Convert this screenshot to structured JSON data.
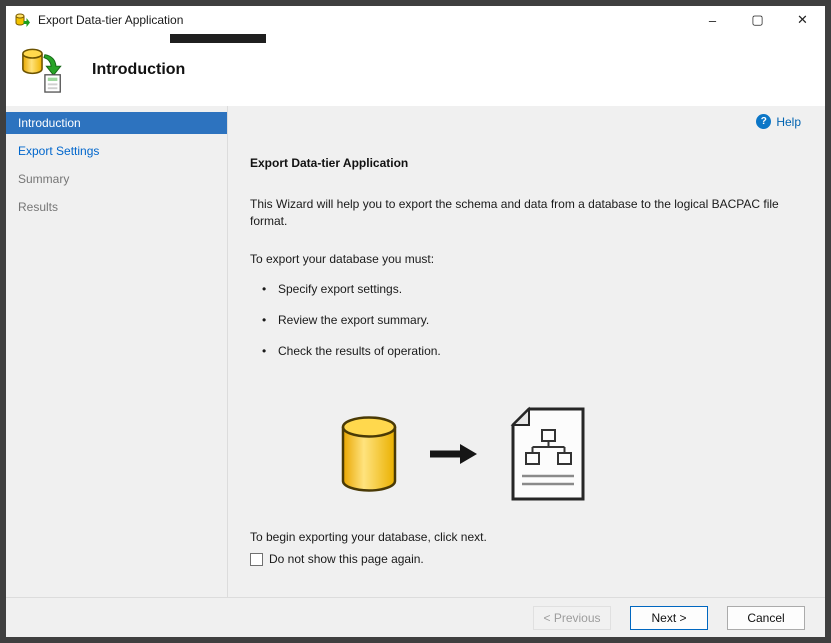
{
  "window": {
    "title": "Export Data-tier Application",
    "controls": {
      "minimize": "–",
      "maximize": "▢",
      "close": "✕"
    }
  },
  "header": {
    "page_title": "Introduction"
  },
  "sidebar": {
    "items": [
      {
        "label": "Introduction",
        "state": "active"
      },
      {
        "label": "Export Settings",
        "state": "enabled"
      },
      {
        "label": "Summary",
        "state": "pending"
      },
      {
        "label": "Results",
        "state": "pending"
      }
    ]
  },
  "content": {
    "help_label": "Help",
    "help_icon": "?",
    "heading": "Export Data-tier Application",
    "description": "This Wizard will help you to export the schema and data from a database to the logical BACPAC file format.",
    "requirements_intro": "To export your database you must:",
    "bullets": [
      "Specify export settings.",
      "Review the export summary.",
      "Check the results of operation."
    ],
    "begin_text": "To begin exporting your database, click next.",
    "checkbox": {
      "label": "Do not show this page again.",
      "checked": false
    }
  },
  "footer": {
    "previous_label": "< Previous",
    "next_label": "Next >",
    "cancel_label": "Cancel"
  },
  "colors": {
    "accent_blue": "#0067c0",
    "sidebar_active_bg": "#2d73bf",
    "link_blue": "#0066cc",
    "disabled_text": "#767676",
    "database_yellow": "#ffd84d",
    "arrow_green": "#28a428"
  }
}
